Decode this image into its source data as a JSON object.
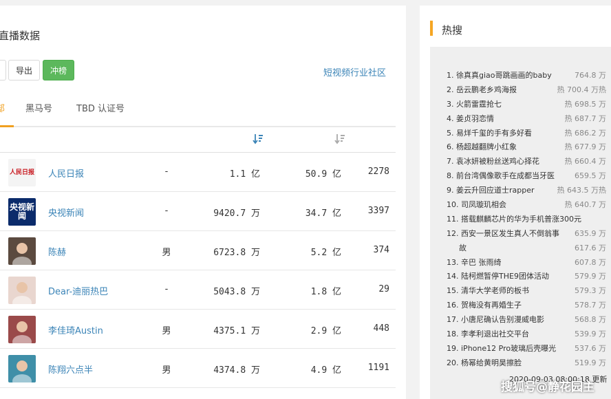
{
  "page": {
    "title": "直播数据"
  },
  "toolbar": {
    "export_label": "导出",
    "rank_label": "冲榜",
    "community_link": "短视频行业社区"
  },
  "tabs": {
    "active_label": "部",
    "dark_horse_label": "黑马号",
    "tbd_label": "TBD 认证号"
  },
  "table": {
    "rows": [
      {
        "name": "人民日报",
        "gender": "-",
        "fans": "1.1 亿",
        "likes": "50.9 亿",
        "works": "2278",
        "avatar_text": "人民日报",
        "avatar_bg": "#f4f4f4",
        "avatar_fg": "#c8161d"
      },
      {
        "name": "央视新闻",
        "gender": "-",
        "fans": "9420.7 万",
        "likes": "34.7 亿",
        "works": "3397",
        "avatar_text": "央视新闻",
        "avatar_bg": "#0b2b6b",
        "avatar_fg": "#ffffff"
      },
      {
        "name": "陈赫",
        "gender": "男",
        "fans": "6723.8 万",
        "likes": "5.2 亿",
        "works": "374",
        "avatar_bg": "#5b4a3f"
      },
      {
        "name": "Dear-迪丽热巴",
        "gender": "-",
        "fans": "5043.8 万",
        "likes": "1.8 亿",
        "works": "29",
        "avatar_bg": "#e9d6cf"
      },
      {
        "name": "李佳琦Austin",
        "gender": "男",
        "fans": "4375.1 万",
        "likes": "2.9 亿",
        "works": "448",
        "avatar_bg": "#9a4a4a"
      },
      {
        "name": "陈翔六点半",
        "gender": "男",
        "fans": "4374.8 万",
        "likes": "4.9 亿",
        "works": "1191",
        "avatar_bg": "#3f8fa8"
      }
    ]
  },
  "hot_search": {
    "title": "热搜",
    "items": [
      {
        "rank": "1.",
        "text": "徐真真giao哥跳画画的baby",
        "value": "764.8 万"
      },
      {
        "rank": "2.",
        "text": "岳云鹏老乡鸡海报",
        "value": "热 700.4 万热"
      },
      {
        "rank": "3.",
        "text": "火箭雷霆抢七",
        "value": "热 698.5 万"
      },
      {
        "rank": "4.",
        "text": "姜贞羽恋情",
        "value": "热 687.7 万"
      },
      {
        "rank": "5.",
        "text": "易烊千玺的手有多好看",
        "value": "热 686.2 万"
      },
      {
        "rank": "6.",
        "text": "杨超越翻牌小红象",
        "value": "热 677.9 万"
      },
      {
        "rank": "7.",
        "text": "袁冰妍被粉丝送鸡心择花",
        "value": "热 660.4 万"
      },
      {
        "rank": "8.",
        "text": "前台湾偶像歌手在成都当牙医",
        "value": "659.5 万"
      },
      {
        "rank": "9.",
        "text": "姜云升回应道士rapper",
        "value": "热 643.5 万热"
      },
      {
        "rank": "10.",
        "text": "司凤璇玑相会",
        "value": "热 640.7 万"
      },
      {
        "rank": "11.",
        "text": "搭载麒麟芯片的华为手机普涨300元",
        "value": ""
      },
      {
        "rank": "12.",
        "text": "西安一景区发生真人不倒翁事",
        "value": "635.9 万"
      },
      {
        "rank": "",
        "text": "故",
        "value": "617.6 万"
      },
      {
        "rank": "13.",
        "text": "辛巴 张雨绮",
        "value": "607.8 万"
      },
      {
        "rank": "14.",
        "text": "陆柯燃暂停THE9团体活动",
        "value": "579.9 万"
      },
      {
        "rank": "15.",
        "text": "清华大学老师的板书",
        "value": "579.3 万"
      },
      {
        "rank": "16.",
        "text": "贺梅没有再婚生子",
        "value": "578.7 万"
      },
      {
        "rank": "17.",
        "text": "小唐尼确认告别漫威电影",
        "value": "568.8 万"
      },
      {
        "rank": "18.",
        "text": "李孝利退出社交平台",
        "value": "539.9 万"
      },
      {
        "rank": "19.",
        "text": "iPhone12 Pro玻璃后壳曝光",
        "value": "537.6 万"
      },
      {
        "rank": "20.",
        "text": "杨幂给黄明昊擦脸",
        "value": "519.9 万"
      }
    ],
    "updated": "2020-09-03 08:00:18 更新"
  },
  "watermark": "搜狐号@静花园主",
  "colors": {
    "accent": "#f0a020",
    "link": "#3b84b7",
    "green_button": "#5cb85c"
  }
}
